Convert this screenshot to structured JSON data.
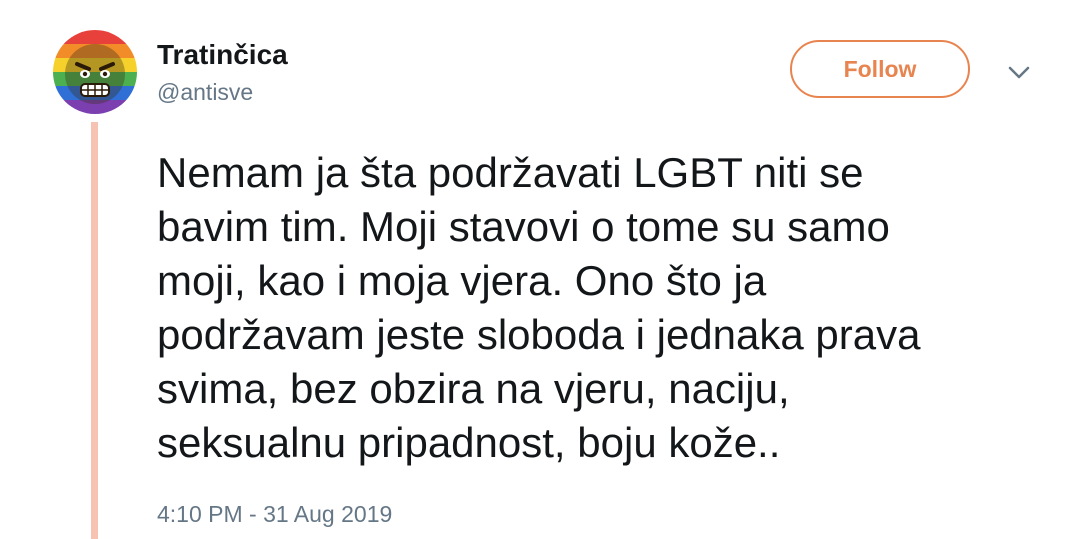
{
  "user": {
    "display_name": "Tratinčica",
    "handle": "@antisve",
    "avatar_icon": "angry-face-rainbow-avatar"
  },
  "actions": {
    "follow_label": "Follow",
    "more_icon": "chevron-down-icon"
  },
  "tweet": {
    "lines": [
      "Nemam ja šta podržavati LGBT niti se",
      "bavim tim. Moji stavovi o tome su samo",
      "moji, kao i moja vjera. Ono što ja",
      "podržavam jeste sloboda i jednaka prava",
      "svima, bez obzira na vjeru, naciju,",
      "seksualnu pripadnost, boju kože.."
    ],
    "timestamp": "4:10 PM - 31 Aug 2019"
  },
  "colors": {
    "accent": "#e8844f",
    "thread_line": "#f6c2b1",
    "text": "#14171a",
    "secondary_text": "#657786"
  }
}
